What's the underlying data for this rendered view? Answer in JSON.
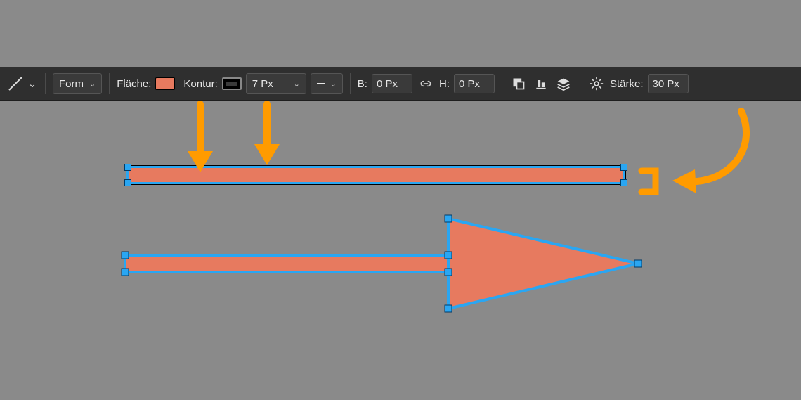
{
  "toolbar": {
    "tool_menu_label": "",
    "mode_label": "Form",
    "fill_label": "Fläche:",
    "stroke_label": "Kontur:",
    "stroke_width_value": "7 Px",
    "width_prefix": "B:",
    "width_value": "0 Px",
    "height_prefix": "H:",
    "height_value": "0 Px",
    "thickness_label": "Stärke:",
    "thickness_value": "30 Px",
    "fill_color": "#e77a5f",
    "stroke_color": "#000000"
  },
  "canvas": {
    "shapes": [
      {
        "type": "line-shape",
        "fill": "#e77a5f",
        "selected": true
      },
      {
        "type": "arrow-shape",
        "fill": "#e77a5f",
        "selected": true
      }
    ]
  }
}
